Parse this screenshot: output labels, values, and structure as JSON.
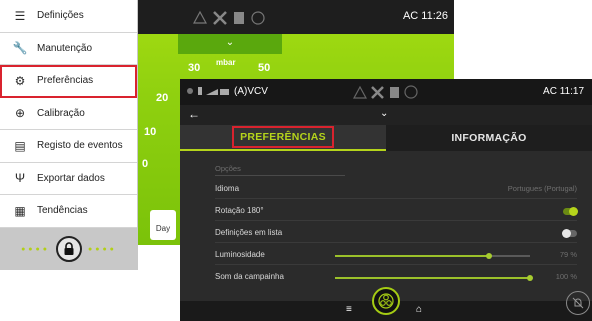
{
  "menu": {
    "items": [
      {
        "label": "Definições",
        "icon": "sliders-icon"
      },
      {
        "label": "Manutenção",
        "icon": "wrench-icon"
      },
      {
        "label": "Preferências",
        "icon": "gear-icon"
      },
      {
        "label": "Calibração",
        "icon": "calibration-icon"
      },
      {
        "label": "Registo de eventos",
        "icon": "clipboard-icon"
      },
      {
        "label": "Exportar dados",
        "icon": "usb-icon"
      },
      {
        "label": "Tendências",
        "icon": "grid-icon"
      }
    ],
    "highlight_color": "#d9232e"
  },
  "background_device": {
    "time": "AC 11:26",
    "gauge_labels": [
      "20",
      "30",
      "50",
      "10",
      "0"
    ],
    "gauge_unit": "mbar",
    "day_label": "Day"
  },
  "device": {
    "mode": "(A)VCV",
    "time": "AC 11:17",
    "tabs": [
      {
        "label": "PREFERÊNCIAS",
        "active": true
      },
      {
        "label": "INFORMAÇÃO",
        "active": false
      }
    ],
    "section_title": "Opções",
    "settings": [
      {
        "label": "Idioma",
        "value": "Portugues (Portugal)"
      },
      {
        "label": "Rotação 180°",
        "toggle": true
      },
      {
        "label": "Definições em lista",
        "toggle": false
      },
      {
        "label": "Luminosidade",
        "value": "79 %",
        "slider": 0.79
      },
      {
        "label": "Som da campainha",
        "value": "100 %",
        "slider": 1.0
      }
    ],
    "accent": "#b5d41b"
  }
}
